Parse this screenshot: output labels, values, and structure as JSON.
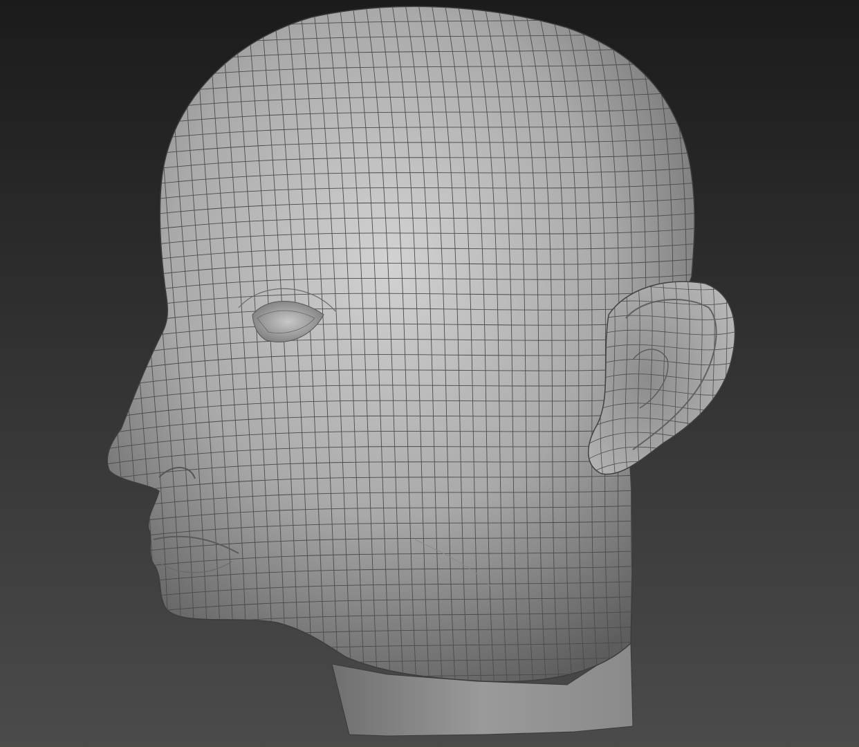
{
  "viewport": {
    "background_top": "#1b1b1b",
    "background_bottom": "#4b4b4b",
    "model": {
      "name": "head-mesh",
      "shading": "smooth-shaded-with-wireframe",
      "surface_color": "#a9a9a9",
      "highlight_color": "#d2d2d2",
      "shadow_color": "#5d5d5d",
      "wire_color": "#4a4a4a",
      "orientation": "three-quarter-left"
    }
  }
}
